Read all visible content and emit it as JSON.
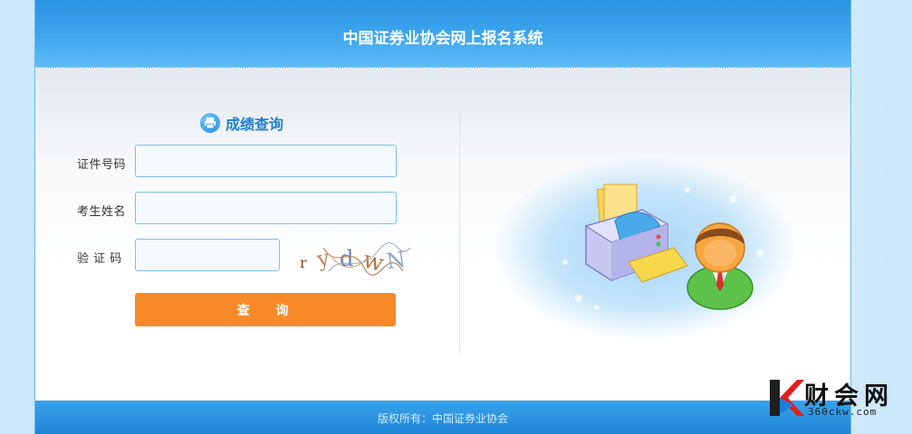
{
  "header": {
    "title": "中国证券业协会网上报名系统"
  },
  "form": {
    "heading": "成绩查询",
    "heading_icon": "printer-icon",
    "id_label": "证件号码",
    "id_value": "",
    "name_label": "考生姓名",
    "name_value": "",
    "captcha_label": "验 证 码",
    "captcha_value": "",
    "captcha_chars": [
      "r",
      "y",
      "d",
      "w",
      "N"
    ],
    "submit_label": "查 询"
  },
  "illustration": {
    "icon_name": "printer-and-user-icon"
  },
  "footer": {
    "copyright": "版权所有：中国证券业协会"
  },
  "watermark": {
    "name": "财会网",
    "url": "360ckw.com",
    "logo": "k-logo-icon"
  },
  "colors": {
    "header_blue": "#2a93e3",
    "heading_blue": "#1f7fd0",
    "button_orange": "#f68a28",
    "input_border": "#7fbde7"
  }
}
